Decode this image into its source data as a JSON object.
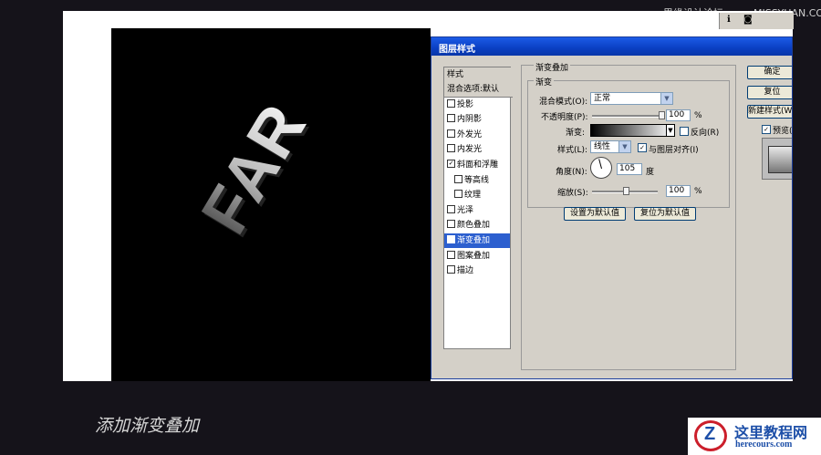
{
  "watermark": "思缘设计论坛 www.MISSYUAN.COM",
  "canvas": {
    "artwork_text": "FAR"
  },
  "dialog": {
    "title": "图层样式",
    "styles_header": "样式",
    "styles_list": [
      {
        "label": "混合选项:默认",
        "checkbox": false,
        "checked": false,
        "selected": false,
        "header": true
      },
      {
        "label": "投影",
        "checkbox": true,
        "checked": false,
        "selected": false
      },
      {
        "label": "内阴影",
        "checkbox": true,
        "checked": false,
        "selected": false
      },
      {
        "label": "外发光",
        "checkbox": true,
        "checked": false,
        "selected": false
      },
      {
        "label": "内发光",
        "checkbox": true,
        "checked": false,
        "selected": false
      },
      {
        "label": "斜面和浮雕",
        "checkbox": true,
        "checked": true,
        "selected": false
      },
      {
        "label": "等高线",
        "checkbox": true,
        "checked": false,
        "selected": false,
        "indent": true
      },
      {
        "label": "纹理",
        "checkbox": true,
        "checked": false,
        "selected": false,
        "indent": true
      },
      {
        "label": "光泽",
        "checkbox": true,
        "checked": false,
        "selected": false
      },
      {
        "label": "颜色叠加",
        "checkbox": true,
        "checked": false,
        "selected": false
      },
      {
        "label": "渐变叠加",
        "checkbox": true,
        "checked": true,
        "selected": true
      },
      {
        "label": "图案叠加",
        "checkbox": true,
        "checked": false,
        "selected": false
      },
      {
        "label": "描边",
        "checkbox": true,
        "checked": false,
        "selected": false
      }
    ],
    "group_title": "渐变叠加",
    "subgroup_title": "渐变",
    "blend_mode_label": "混合模式(O):",
    "blend_mode_value": "正常",
    "opacity_label": "不透明度(P):",
    "opacity_value": "100",
    "opacity_unit": "%",
    "opacity_level": 1.0,
    "gradient_label": "渐变:",
    "reverse_label": "反向(R)",
    "reverse_checked": false,
    "style_label": "样式(L):",
    "style_value": "线性",
    "align_label": "与图层对齐(I)",
    "align_checked": true,
    "angle_label": "角度(N):",
    "angle_value": "105",
    "angle_unit": "度",
    "scale_label": "缩放(S):",
    "scale_value": "100",
    "scale_unit": "%",
    "scale_level": 0.5,
    "set_default_button": "设置为默认值",
    "reset_default_button": "复位为默认值",
    "ok_button": "确定",
    "reset_button": "复位",
    "new_style_button": "新建样式(W)...",
    "preview_label": "预览(V)",
    "preview_checked": true
  },
  "caption": "添加渐变叠加",
  "logo": {
    "name": "这里教程网",
    "url": "herecours.com",
    "letter": "Z"
  },
  "colors": {
    "titlebar": "#0a3fc2",
    "selection": "#2c5fcf",
    "logo_red": "#cc1f2b",
    "logo_blue": "#1d4fa8"
  }
}
